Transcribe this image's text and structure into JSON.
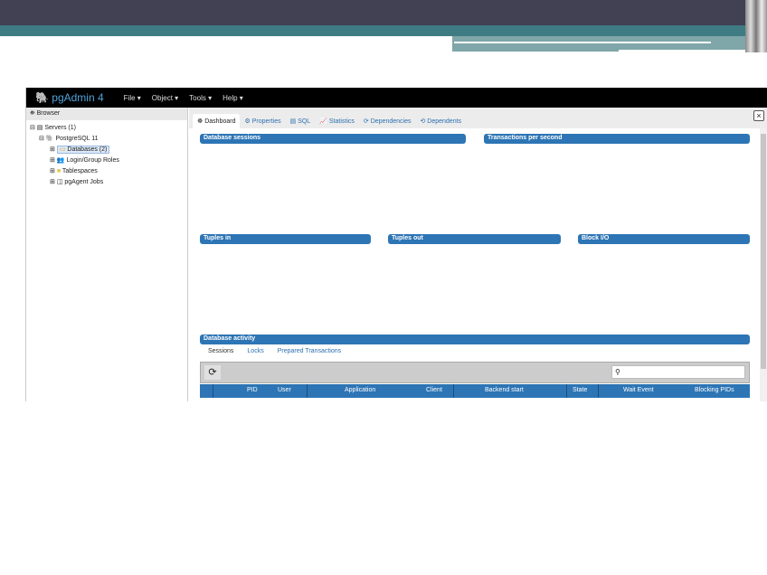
{
  "app": {
    "title": "pgAdmin 4",
    "menus": [
      "File",
      "Object",
      "Tools",
      "Help"
    ]
  },
  "browser": {
    "title": "Browser",
    "tree": [
      "Servers (1)",
      "PostgreSQL 11",
      "Databases (2)",
      "Login/Group Roles",
      "Tablespaces",
      "pgAgent Jobs"
    ]
  },
  "tabs": [
    "Dashboard",
    "Properties",
    "SQL",
    "Statistics",
    "Dependencies",
    "Dependents"
  ],
  "panels": {
    "sessions": "Database sessions",
    "tps": "Transactions per second",
    "tuples_in": "Tuples in",
    "tuples_out": "Tuples out",
    "block_io": "Block I/O",
    "activity": "Database activity"
  },
  "subtabs": [
    "Sessions",
    "Locks",
    "Prepared Transactions"
  ],
  "columns": [
    "PID",
    "User",
    "Application",
    "Client",
    "Backend start",
    "State",
    "Wait Event",
    "Blocking PIDs"
  ]
}
